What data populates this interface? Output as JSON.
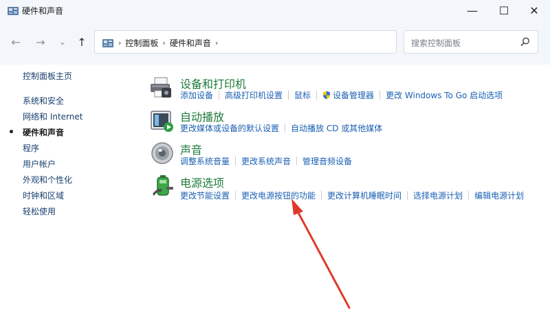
{
  "window": {
    "title": "硬件和声音",
    "minimize_glyph": "—",
    "maximize_glyph": "☐",
    "close_glyph": "✕"
  },
  "nav": {
    "back": "←",
    "forward": "→",
    "recent": "⌄",
    "up": "↑"
  },
  "address": {
    "crumbs": [
      "控制面板",
      "硬件和声音"
    ],
    "sep": "›",
    "dropdown": "⌄",
    "refresh": "↻"
  },
  "search": {
    "placeholder": "搜索控制面板"
  },
  "sidebar": {
    "items": [
      {
        "label": "控制面板主页"
      },
      {
        "label": "系统和安全"
      },
      {
        "label": "网络和 Internet"
      },
      {
        "label": "硬件和声音",
        "active": true
      },
      {
        "label": "程序"
      },
      {
        "label": "用户帐户"
      },
      {
        "label": "外观和个性化"
      },
      {
        "label": "时钟和区域"
      },
      {
        "label": "轻松使用"
      }
    ]
  },
  "categories": [
    {
      "title": "设备和打印机",
      "icon": "printer-icon",
      "links": [
        "添加设备",
        "高级打印机设置",
        "鼠标",
        "设备管理器",
        "更改 Windows To Go 启动选项"
      ]
    },
    {
      "title": "自动播放",
      "icon": "autoplay-icon",
      "links": [
        "更改媒体或设备的默认设置",
        "自动播放 CD 或其他媒体"
      ]
    },
    {
      "title": "声音",
      "icon": "speaker-icon",
      "links": [
        "调整系统音量",
        "更改系统声音",
        "管理音频设备"
      ]
    },
    {
      "title": "电源选项",
      "icon": "battery-icon",
      "links": [
        "更改节能设置",
        "更改电源按钮的功能",
        "更改计算机睡眠时间",
        "选择电源计划",
        "编辑电源计划"
      ]
    }
  ],
  "colors": {
    "link": "#1a5fb4",
    "heading": "#1f7a3a",
    "annotation_arrow": "#e0392b"
  }
}
